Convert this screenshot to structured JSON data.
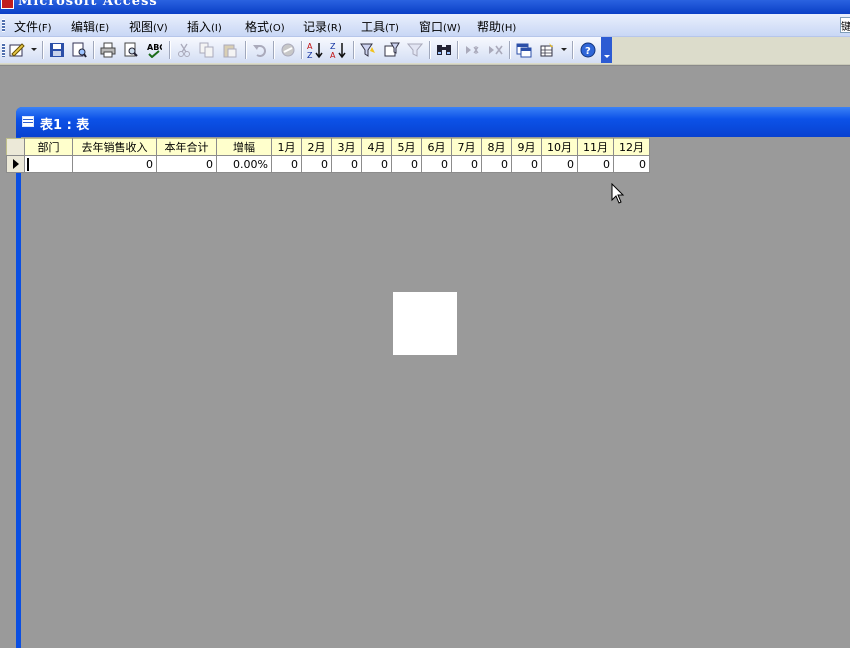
{
  "app": {
    "title": "Microsoft Access",
    "help_box_text": "键"
  },
  "menubar": {
    "items": [
      {
        "label": "文件",
        "accel": "(F)"
      },
      {
        "label": "编辑",
        "accel": "(E)"
      },
      {
        "label": "视图",
        "accel": "(V)"
      },
      {
        "label": "插入",
        "accel": "(I)"
      },
      {
        "label": "格式",
        "accel": "(O)"
      },
      {
        "label": "记录",
        "accel": "(R)"
      },
      {
        "label": "工具",
        "accel": "(T)"
      },
      {
        "label": "窗口",
        "accel": "(W)"
      },
      {
        "label": "帮助",
        "accel": "(H)"
      }
    ]
  },
  "toolbar": {
    "icons": [
      "design-view-icon",
      "save-icon",
      "file-search-icon",
      "print-icon",
      "print-preview-icon",
      "spelling-icon",
      "cut-icon",
      "copy-icon",
      "paste-icon",
      "undo-icon",
      "hyperlink-icon",
      "sort-ascending-icon",
      "sort-descending-icon",
      "filter-by-selection-icon",
      "filter-by-form-icon",
      "apply-filter-icon",
      "find-icon",
      "new-record-icon",
      "delete-record-icon",
      "database-window-icon",
      "new-object-icon",
      "help-icon"
    ]
  },
  "child_window": {
    "title": "表1 : 表"
  },
  "datasheet": {
    "columns": [
      "部门",
      "去年销售收入",
      "本年合计",
      "增幅",
      "1月",
      "2月",
      "3月",
      "4月",
      "5月",
      "6月",
      "7月",
      "8月",
      "9月",
      "10月",
      "11月",
      "12月"
    ],
    "row": [
      "",
      "0",
      "0",
      "0.00%",
      "0",
      "0",
      "0",
      "0",
      "0",
      "0",
      "0",
      "0",
      "0",
      "0",
      "0",
      "0"
    ]
  }
}
